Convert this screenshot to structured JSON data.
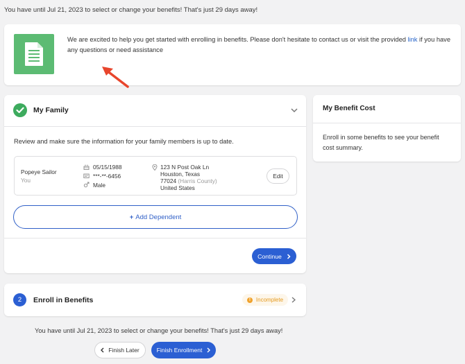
{
  "deadline_top": "You have until Jul 21, 2023 to select or change your benefits! That's just 29 days away!",
  "intro": {
    "text_before_link": "We are excited to help you get started with enrolling in benefits. Please don't hesitate to contact us or visit the provided ",
    "link_text": "link",
    "text_after_link": " if you have any questions or need assistance",
    "icon": "document-icon"
  },
  "family": {
    "title": "My Family",
    "review_text": "Review and make sure the information for your family members is up to date.",
    "member": {
      "name": "Popeye Sailor",
      "relation": "You",
      "dob": "05/15/1988",
      "ssn": "***-**-6456",
      "gender": "Male",
      "address_line1": "123 N Post Oak Ln",
      "address_line2": "Houston, Texas",
      "zip": "77024",
      "county": "(Harris County)",
      "country": "United States",
      "edit_label": "Edit"
    },
    "add_dependent_plus": "+",
    "add_dependent_label": "Add Dependent",
    "continue_label": "Continue"
  },
  "benefit_cost": {
    "title": "My Benefit Cost",
    "text": "Enroll in some benefits to see your benefit cost summary."
  },
  "enroll": {
    "step": "2",
    "title": "Enroll in Benefits",
    "status_mark": "!",
    "status": "Incomplete"
  },
  "deadline_bottom": "You have until Jul 21, 2023 to select or change your benefits! That's just 29 days away!",
  "buttons": {
    "finish_later": "Finish Later",
    "finish_enrollment": "Finish Enrollment"
  },
  "colors": {
    "accent": "#2b5fd3",
    "success": "#3dab5e",
    "doc_tile": "#5cbb73",
    "warning": "#f0a22c",
    "annotation_arrow": "#e8452c"
  }
}
